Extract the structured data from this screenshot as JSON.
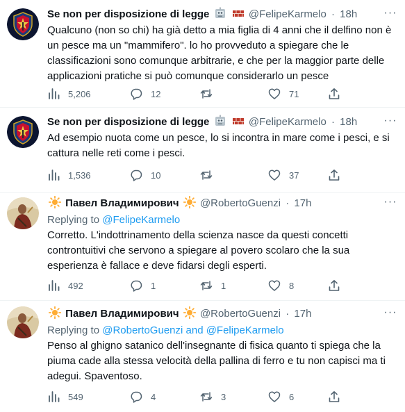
{
  "tweets": [
    {
      "name": "Se non per disposizione di legge",
      "name_emojis": [
        "robot-face-emoji",
        "brick-emoji"
      ],
      "handle": "@FelipeKarmelo",
      "time": "18h",
      "replying_prefix": "",
      "replying_to": "",
      "text": "Qualcuno (non so chi) ha già detto a mia figlia di 4 anni che il delfino non è un pesce ma un \"mammifero\". lo ho provveduto a spiegare che le classificazioni sono comunque arbitrarie, e che per la maggior parte delle applicazioni pratiche si può comunque considerarlo un pesce",
      "views": "5,206",
      "replies": "12",
      "retweets": "",
      "likes": "71"
    },
    {
      "name": "Se non per disposizione di legge",
      "name_emojis": [
        "robot-face-emoji",
        "brick-emoji"
      ],
      "handle": "@FelipeKarmelo",
      "time": "18h",
      "replying_prefix": "",
      "replying_to": "",
      "text": "Ad esempio nuota come un pesce, lo si incontra in mare come i pesci, e si cattura nelle reti come i pesci.",
      "views": "1,536",
      "replies": "10",
      "retweets": "",
      "likes": "37"
    },
    {
      "name": "Павел Владимирович",
      "name_emojis": [
        "sun-emoji",
        "sun-emoji"
      ],
      "handle": "@RobertoGuenzi",
      "time": "17h",
      "replying_prefix": "Replying to",
      "replying_to": "@FelipeKarmelo",
      "text": "Corretto. L'indottrinamento della scienza nasce da questi concetti controntuitivi che servono a spiegare al povero scolaro che la sua esperienza è fallace e deve fidarsi degli esperti.",
      "views": "492",
      "replies": "1",
      "retweets": "1",
      "likes": "8"
    },
    {
      "name": "Павел Владимирович",
      "name_emojis": [
        "sun-emoji",
        "sun-emoji"
      ],
      "handle": "@RobertoGuenzi",
      "time": "17h",
      "replying_prefix": "Replying to",
      "replying_to": "@RobertoGuenzi and @FelipeKarmelo",
      "text": "Penso al ghigno satanico dell'insegnante di fisica quanto ti spiega che la piuma cade alla stessa velocità della pallina di ferro e tu non capisci ma ti adegui. Spaventoso.",
      "views": "549",
      "replies": "4",
      "retweets": "3",
      "likes": "6"
    }
  ],
  "colors": {
    "text": "#0f1419",
    "secondary": "#536471",
    "link": "#1d9bf0",
    "divider": "#eff3f4"
  },
  "icons": {
    "views": "bar-chart-icon",
    "reply": "speech-bubble-icon",
    "retweet": "retweet-arrows-icon",
    "like": "heart-icon",
    "share": "share-arrow-icon",
    "more": "ellipsis-icon"
  }
}
